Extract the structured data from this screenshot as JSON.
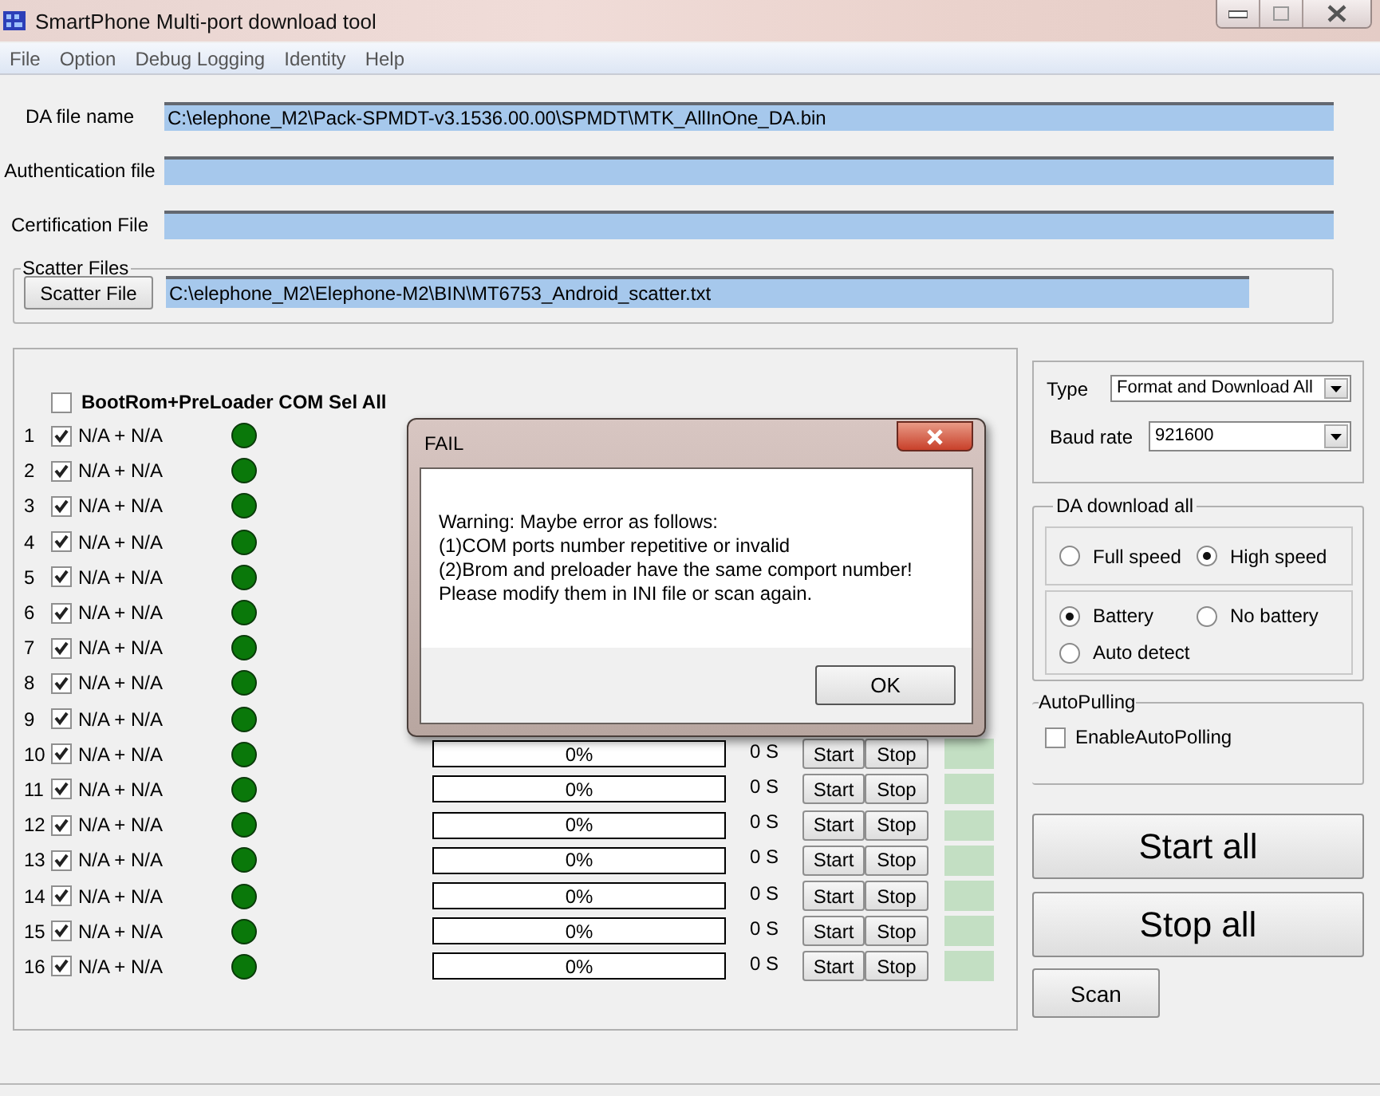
{
  "window": {
    "title": "SmartPhone Multi-port download tool"
  },
  "menu": [
    "File",
    "Option",
    "Debug Logging",
    "Identity",
    "Help"
  ],
  "files": [
    {
      "label": "DA file name",
      "value": "C:\\elephone_M2\\Pack-SPMDT-v3.1536.00.00\\SPMDT\\MTK_AllInOne_DA.bin"
    },
    {
      "label": "Authentication file"
    },
    {
      "label": "Certification File"
    }
  ],
  "scatter": {
    "group_title": "Scatter Files",
    "button": "Scatter File",
    "value": "C:\\elephone_M2\\Elephone-M2\\BIN\\MT6753_Android_scatter.txt"
  },
  "ports": {
    "select_all": {
      "label": "BootRom+PreLoader COM Sel All",
      "checked": false
    },
    "rows": [
      {
        "number": "1",
        "checked": true,
        "name": "N/A + N/A",
        "color": "#0a780a"
      },
      {
        "number": "2",
        "checked": true,
        "name": "N/A + N/A",
        "color": "#0a780a"
      },
      {
        "number": "3",
        "checked": true,
        "name": "N/A + N/A",
        "color": "#0a780a"
      },
      {
        "number": "4",
        "checked": true,
        "name": "N/A + N/A",
        "color": "#0a780a"
      },
      {
        "number": "5",
        "checked": true,
        "name": "N/A + N/A",
        "color": "#0a780a"
      },
      {
        "number": "6",
        "checked": true,
        "name": "N/A + N/A",
        "color": "#0a780a"
      },
      {
        "number": "7",
        "checked": true,
        "name": "N/A + N/A",
        "color": "#0a780a"
      },
      {
        "number": "8",
        "checked": true,
        "name": "N/A + N/A",
        "color": "#0a780a"
      },
      {
        "number": "9",
        "checked": true,
        "name": "N/A + N/A",
        "color": "#0a780a"
      },
      {
        "number": "10",
        "checked": true,
        "name": "N/A + N/A",
        "color": "#0a780a",
        "progress": "0%",
        "level": 0,
        "time": "0 S",
        "start": "Start",
        "stop": "Stop"
      },
      {
        "number": "11",
        "checked": true,
        "name": "N/A + N/A",
        "color": "#0a780a",
        "progress": "0%",
        "level": 0,
        "time": "0 S",
        "start": "Start",
        "stop": "Stop"
      },
      {
        "number": "12",
        "checked": true,
        "name": "N/A + N/A",
        "color": "#0a780a",
        "progress": "0%",
        "level": 0,
        "time": "0 S",
        "start": "Start",
        "stop": "Stop"
      },
      {
        "number": "13",
        "checked": true,
        "name": "N/A + N/A",
        "color": "#0a780a",
        "progress": "0%",
        "level": 0,
        "time": "0 S",
        "start": "Start",
        "stop": "Stop"
      },
      {
        "number": "14",
        "checked": true,
        "name": "N/A + N/A",
        "color": "#0a780a",
        "progress": "0%",
        "level": 0,
        "time": "0 S",
        "start": "Start",
        "stop": "Stop"
      },
      {
        "number": "15",
        "checked": true,
        "name": "N/A + N/A",
        "color": "#0a780a",
        "progress": "0%",
        "level": 0,
        "time": "0 S",
        "start": "Start",
        "stop": "Stop"
      },
      {
        "number": "16",
        "checked": true,
        "name": "N/A + N/A",
        "color": "#0a780a",
        "progress": "0%",
        "level": 0,
        "time": "0 S",
        "start": "Start",
        "stop": "Stop"
      }
    ]
  },
  "type": {
    "label": "Type",
    "value": "Format and Download All"
  },
  "baud_rate": {
    "label": "Baud rate",
    "value": "921600"
  },
  "da_download": {
    "title": "DA download all",
    "speed": [
      {
        "label": "Full speed",
        "selected": false
      },
      {
        "label": "High speed",
        "selected": true
      }
    ],
    "power": [
      {
        "label": "Battery",
        "selected": true
      },
      {
        "label": "No battery",
        "selected": false
      },
      {
        "label": "Auto detect",
        "selected": false
      }
    ]
  },
  "auto_pulling": {
    "title": "AutoPulling",
    "checkbox": {
      "label": "EnableAutoPolling",
      "checked": false
    }
  },
  "buttons": {
    "start_all": "Start all",
    "stop_all": "Stop all",
    "scan": "Scan"
  },
  "dialog": {
    "title": "FAIL",
    "lines": [
      "Warning: Maybe error as follows:",
      "(1)COM ports number repetitive or invalid",
      "(2)Brom and preloader have the same comport number!",
      "Please modify them in INI file or scan again."
    ],
    "button": "OK"
  }
}
